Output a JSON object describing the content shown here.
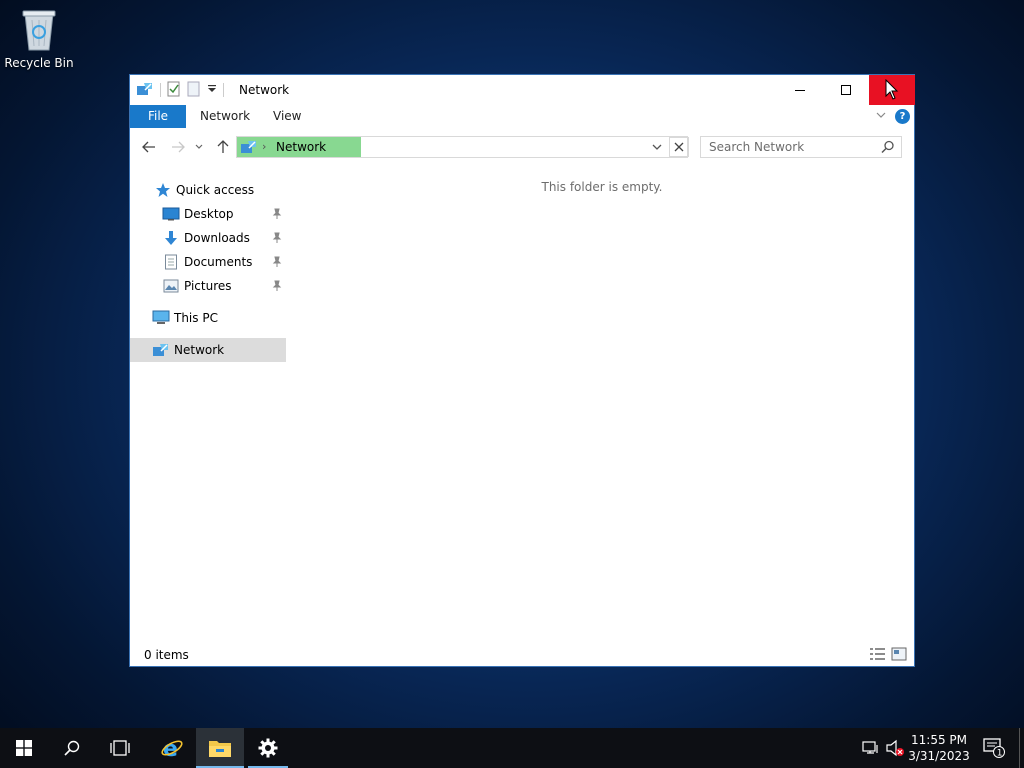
{
  "desktop": {
    "recycle_bin_label": "Recycle Bin"
  },
  "window": {
    "title": "Network",
    "ribbon": {
      "tabs": [
        "File",
        "Network",
        "View"
      ]
    },
    "address": {
      "crumb": "Network"
    },
    "search": {
      "placeholder": "Search Network"
    },
    "nav": {
      "quick_access": "Quick access",
      "items": [
        {
          "label": "Desktop",
          "pinned": true
        },
        {
          "label": "Downloads",
          "pinned": true
        },
        {
          "label": "Documents",
          "pinned": true
        },
        {
          "label": "Pictures",
          "pinned": true
        }
      ],
      "this_pc": "This PC",
      "network": "Network"
    },
    "content": {
      "empty_message": "This folder is empty."
    },
    "status": {
      "item_count": "0 items"
    }
  },
  "taskbar": {
    "time": "11:55 PM",
    "date": "3/31/2023",
    "notification_count": "1"
  },
  "colors": {
    "accent": "#1979ca",
    "close_button": "#e81123",
    "selected_crumb": "#88d891",
    "nav_selected": "#dcdcdc"
  }
}
